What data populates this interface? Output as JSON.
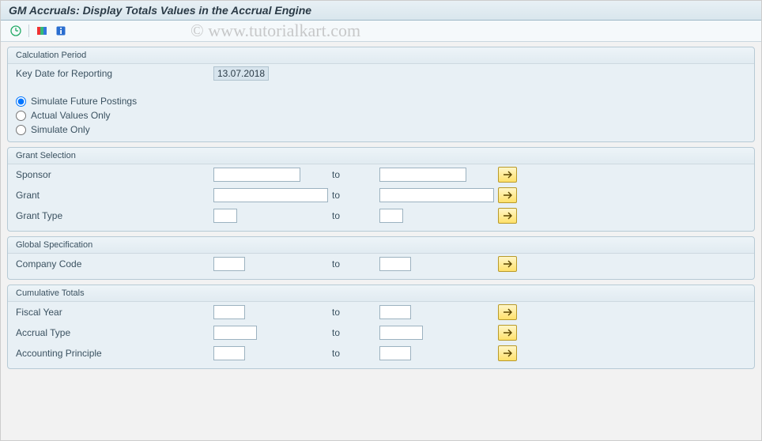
{
  "title": "GM Accruals: Display Totals Values in the Accrual Engine",
  "watermark": "© www.tutorialkart.com",
  "toolbar": {
    "execute": "execute",
    "variants": "variants",
    "info": "info"
  },
  "groups": {
    "calcPeriod": {
      "title": "Calculation Period",
      "keyDateLabel": "Key Date for Reporting",
      "keyDateValue": "13.07.2018",
      "radios": {
        "simFuture": "Simulate Future Postings",
        "actualOnly": "Actual Values Only",
        "simOnly": "Simulate Only"
      }
    },
    "grantSel": {
      "title": "Grant Selection",
      "to": "to",
      "rows": {
        "sponsor": "Sponsor",
        "grant": "Grant",
        "grantType": "Grant Type"
      }
    },
    "globalSpec": {
      "title": "Global Specification",
      "to": "to",
      "rows": {
        "companyCode": "Company Code"
      }
    },
    "cumTotals": {
      "title": "Cumulative Totals",
      "to": "to",
      "rows": {
        "fiscalYear": "Fiscal Year",
        "accrualType": "Accrual Type",
        "acctPrinciple": "Accounting Principle"
      }
    }
  }
}
